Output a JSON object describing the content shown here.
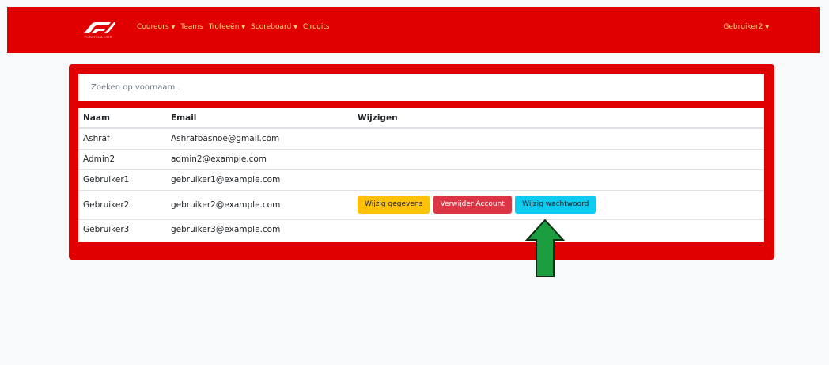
{
  "navbar": {
    "brand_sub": "FORMULA ONE",
    "links": [
      {
        "label": "Coureurs",
        "dropdown": true
      },
      {
        "label": "Teams",
        "dropdown": false
      },
      {
        "label": "Trofeeën",
        "dropdown": true
      },
      {
        "label": "Scoreboard",
        "dropdown": true
      },
      {
        "label": "Circuits",
        "dropdown": false
      }
    ],
    "user": "Gebruiker2"
  },
  "search": {
    "placeholder": "Zoeken op voornaam.."
  },
  "table": {
    "headers": [
      "Naam",
      "Email",
      "Wijzigen"
    ],
    "rows": [
      {
        "naam": "Ashraf",
        "email": "Ashrafbasnoe@gmail.com"
      },
      {
        "naam": "Admin2",
        "email": "admin2@example.com"
      },
      {
        "naam": "Gebruiker1",
        "email": "gebruiker1@example.com"
      },
      {
        "naam": "Gebruiker2",
        "email": "gebruiker2@example.com"
      },
      {
        "naam": "Gebruiker3",
        "email": "gebruiker3@example.com"
      }
    ]
  },
  "actions": {
    "edit": "Wijzig gegevens",
    "delete": "Verwijder Account",
    "password": "Wijzig wachtwoord"
  },
  "colors": {
    "primary": "#e00000",
    "nav_text": "#ffd27a",
    "warning": "#ffc107",
    "danger": "#dc3545",
    "info": "#0dcaf0",
    "arrow": "#1a9e3f"
  }
}
